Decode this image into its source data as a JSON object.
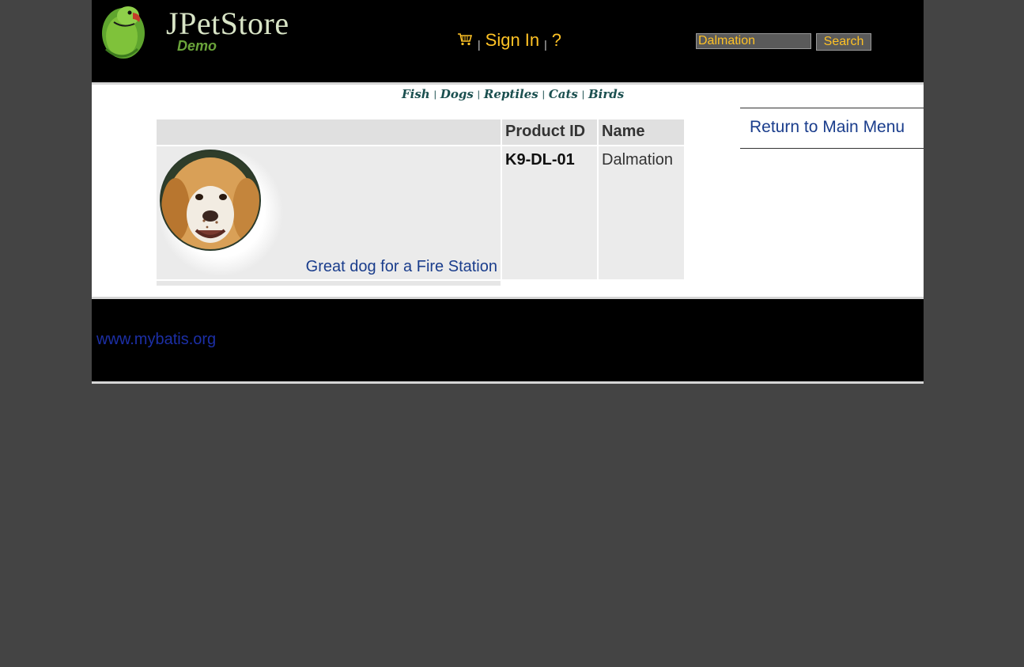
{
  "header": {
    "logo_title": "JPetStore",
    "logo_subtitle": "Demo",
    "menu": {
      "sign_in_label": "Sign In",
      "help_label": "?",
      "separator": "|"
    },
    "search": {
      "input_value": "Dalmation",
      "button_label": "Search"
    }
  },
  "quick_links": {
    "separator": "|",
    "items": [
      "Fish",
      "Dogs",
      "Reptiles",
      "Cats",
      "Birds"
    ]
  },
  "product_table": {
    "headers": {
      "image": "",
      "product_id": "Product ID",
      "name": "Name"
    },
    "rows": [
      {
        "description": "Great dog for a Fire Station",
        "product_id": "K9-DL-01",
        "name": "Dalmation"
      }
    ]
  },
  "sidebar": {
    "return_link": "Return to Main Menu"
  },
  "footer": {
    "link": "www.mybatis.org"
  },
  "colors": {
    "page_background": "#444444",
    "header_background": "#000000",
    "menu_text": "#ffc225",
    "link_blue": "#1a3d8c",
    "footer_link": "#1c2fa6"
  },
  "icons": [
    "parrot-logo-icon",
    "cart-icon",
    "dog-photo"
  ]
}
